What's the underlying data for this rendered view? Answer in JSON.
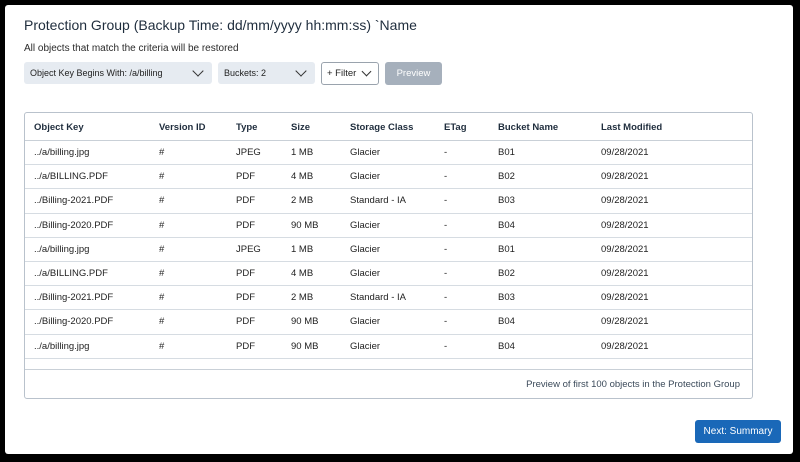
{
  "header": {
    "title": "Protection Group (Backup Time: dd/mm/yyyy hh:mm:ss) `Name",
    "subtitle": "All objects that match the criteria will be restored"
  },
  "toolbar": {
    "object_key_filter": "Object Key Begins With: /a/billing",
    "buckets_filter": "Buckets: 2",
    "filter_label": "+ Filter",
    "preview_label": "Preview"
  },
  "table": {
    "columns": [
      "Object Key",
      "Version ID",
      "Type",
      "Size",
      "Storage Class",
      "ETag",
      "Bucket Name",
      "Last Modified"
    ],
    "rows": [
      [
        "../a/billing.jpg",
        "#",
        "JPEG",
        "1 MB",
        "Glacier",
        "-",
        "B01",
        "09/28/2021"
      ],
      [
        "../a/BILLING.PDF",
        "#",
        "PDF",
        "4 MB",
        "Glacier",
        "-",
        "B02",
        "09/28/2021"
      ],
      [
        "../Billing-2021.PDF",
        "#",
        "PDF",
        "2 MB",
        "Standard - IA",
        "-",
        "B03",
        "09/28/2021"
      ],
      [
        "../Billing-2020.PDF",
        "#",
        "PDF",
        "90 MB",
        "Glacier",
        "-",
        "B04",
        "09/28/2021"
      ],
      [
        "../a/billing.jpg",
        "#",
        "JPEG",
        "1 MB",
        "Glacier",
        "-",
        "B01",
        "09/28/2021"
      ],
      [
        "../a/BILLING.PDF",
        "#",
        "PDF",
        "4 MB",
        "Glacier",
        "-",
        "B02",
        "09/28/2021"
      ],
      [
        "../Billing-2021.PDF",
        "#",
        "PDF",
        "2 MB",
        "Standard - IA",
        "-",
        "B03",
        "09/28/2021"
      ],
      [
        "../Billing-2020.PDF",
        "#",
        "PDF",
        "90 MB",
        "Glacier",
        "-",
        "B04",
        "09/28/2021"
      ],
      [
        "../a/billing.jpg",
        "#",
        "PDF",
        "90 MB",
        "Glacier",
        "-",
        "B04",
        "09/28/2021"
      ]
    ],
    "footer_note": "Preview of first 100 objects in the Protection Group"
  },
  "actions": {
    "next_label": "Next: Summary"
  },
  "colors": {
    "primary": "#1a68b8",
    "disabled": "#a6b0bc",
    "dropdown_bg": "#e6ebf1"
  }
}
